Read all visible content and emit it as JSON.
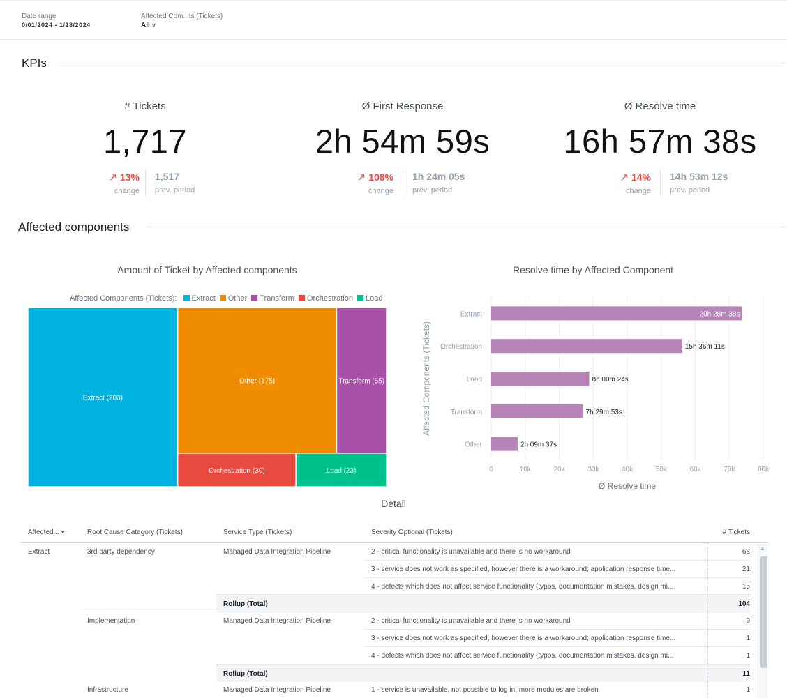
{
  "filters": {
    "date_range": {
      "label": "Date range",
      "value": "0/01/2024 - 1/28/2024"
    },
    "affected": {
      "label": "Affected Com...ts (Tickets)",
      "value": "All"
    }
  },
  "sections": {
    "kpis": "KPIs",
    "affected": "Affected components"
  },
  "kpis": [
    {
      "name": "# Tickets",
      "value": "1,717",
      "change": "13%",
      "change_label": "change",
      "prev": "1,517",
      "prev_label": "prev. period"
    },
    {
      "name": "Ø First Response",
      "value": "2h 54m 59s",
      "change": "108%",
      "change_label": "change",
      "prev": "1h 24m 05s",
      "prev_label": "prev. period"
    },
    {
      "name": "Ø Resolve time",
      "value": "16h 57m 38s",
      "change": "14%",
      "change_label": "change",
      "prev": "14h 53m 12s",
      "prev_label": "prev. period"
    }
  ],
  "chart_data": [
    {
      "type": "treemap",
      "title": "Amount of Ticket by Affected components",
      "legend_title": "Affected Components (Tickets):",
      "legend_position": "top",
      "items": [
        {
          "name": "Extract",
          "value": 203,
          "label": "Extract (203)",
          "color": "#00b2e0"
        },
        {
          "name": "Other",
          "value": 175,
          "label": "Other (175)",
          "color": "#f08c00"
        },
        {
          "name": "Transform",
          "value": 55,
          "label": "Transform (55)",
          "color": "#a84fa9"
        },
        {
          "name": "Orchestration",
          "value": 30,
          "label": "Orchestration (30)",
          "color": "#e84a3f"
        },
        {
          "name": "Load",
          "value": 23,
          "label": "Load (23)",
          "color": "#00c18c"
        }
      ]
    },
    {
      "type": "bar",
      "orientation": "horizontal",
      "title": "Resolve time by Affected Component",
      "xlabel": "Ø Resolve time",
      "ylabel": "Affected Components (Tickets)",
      "xlim": [
        0,
        80000
      ],
      "xticks": [
        "0",
        "10k",
        "20k",
        "30k",
        "40k",
        "50k",
        "60k",
        "70k",
        "80k"
      ],
      "categories": [
        "Extract",
        "Orchestration",
        "Load",
        "Transform",
        "Other"
      ],
      "values": [
        73718,
        56171,
        28824,
        26993,
        7777
      ],
      "labels": [
        "20h 28m 38s",
        "15h 36m 11s",
        "8h 00m 24s",
        "7h 29m 53s",
        "2h 09m 37s"
      ],
      "color": "#b784b7",
      "grid": true
    }
  ],
  "detail": {
    "title": "Detail",
    "columns": [
      "Affected...",
      "Root Cause Category (Tickets)",
      "Service Type (Tickets)",
      "Severity Optional (Tickets)",
      "# Tickets"
    ],
    "rows": [
      {
        "affected": "Extract",
        "root": "3rd party dependency",
        "service": "Managed Data Integration Pipeline",
        "severity": "2 - critical functionality is unavailable and there is no workaround",
        "tickets": "68"
      },
      {
        "affected": "",
        "root": "",
        "service": "",
        "severity": "3 - service does not work as specified, however there is a workaround; application response time...",
        "tickets": "21"
      },
      {
        "affected": "",
        "root": "",
        "service": "",
        "severity": "4 - defects which does not affect service functionality (typos, documentation mistakes, design mi...",
        "tickets": "15"
      },
      {
        "affected": "",
        "root": "",
        "service": "Rollup (Total)",
        "severity": "",
        "tickets": "104",
        "rollup": true
      },
      {
        "affected": "",
        "root": "Implementation",
        "service": "Managed Data Integration Pipeline",
        "severity": "2 - critical functionality is unavailable and there is no workaround",
        "tickets": "9"
      },
      {
        "affected": "",
        "root": "",
        "service": "",
        "severity": "3 - service does not work as specified, however there is a workaround; application response time...",
        "tickets": "1"
      },
      {
        "affected": "",
        "root": "",
        "service": "",
        "severity": "4 - defects which does not affect service functionality (typos, documentation mistakes, design mi...",
        "tickets": "1"
      },
      {
        "affected": "",
        "root": "",
        "service": "Rollup (Total)",
        "severity": "",
        "tickets": "11",
        "rollup": true
      },
      {
        "affected": "",
        "root": "Infrastructure",
        "service": "Managed Data Integration Pipeline",
        "severity": "1 - service is unavailable, not possible to log in, more modules are broken",
        "tickets": "1"
      }
    ]
  }
}
